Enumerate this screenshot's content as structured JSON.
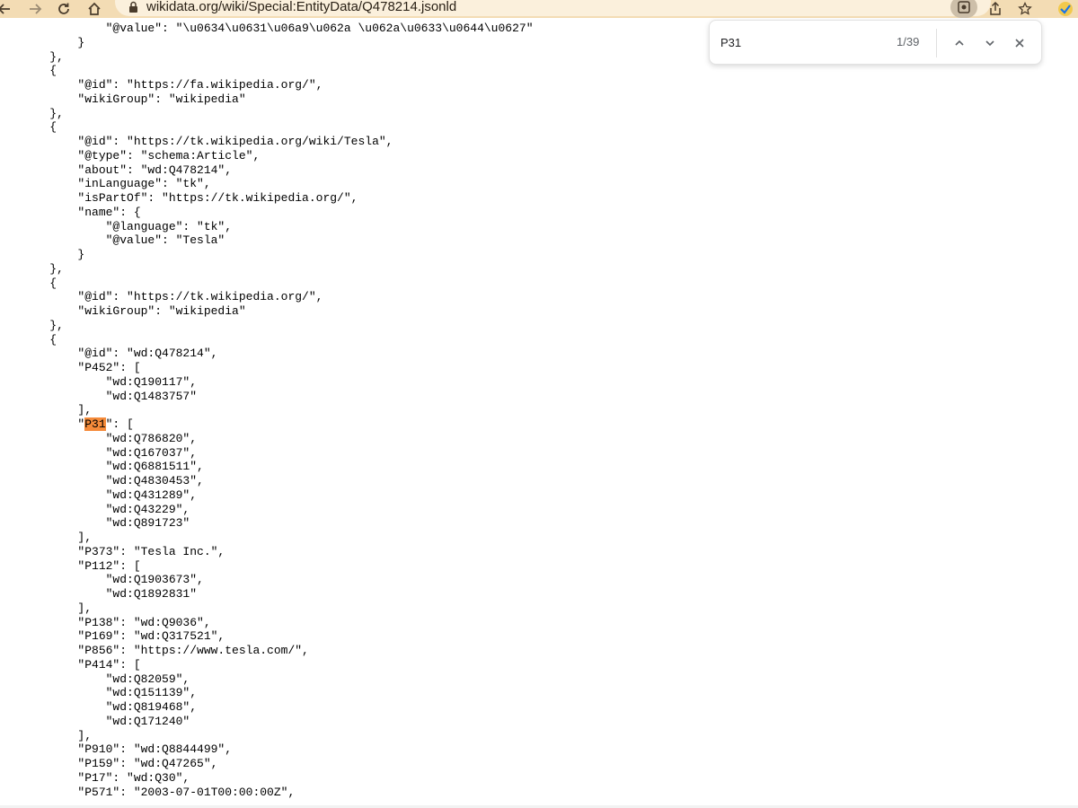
{
  "browser": {
    "url": "wikidata.org/wiki/Special:EntityData/Q478214.jsonld",
    "icons": [
      "back-icon",
      "forward-icon",
      "reload-icon",
      "home-icon",
      "lock-icon",
      "extension-icon",
      "share-icon",
      "star-icon",
      "extension-badge-icon"
    ]
  },
  "find_bar": {
    "query": "P31",
    "count": "1/39",
    "highlight_color": "#f58b3a"
  },
  "code_lines": [
    "            \"@value\": \"\\u0634\\u0631\\u06a9\\u062a \\u062a\\u0633\\u0644\\u0627\"",
    "        }",
    "    },",
    "    {",
    "        \"@id\": \"https://fa.wikipedia.org/\",",
    "        \"wikiGroup\": \"wikipedia\"",
    "    },",
    "    {",
    "        \"@id\": \"https://tk.wikipedia.org/wiki/Tesla\",",
    "        \"@type\": \"schema:Article\",",
    "        \"about\": \"wd:Q478214\",",
    "        \"inLanguage\": \"tk\",",
    "        \"isPartOf\": \"https://tk.wikipedia.org/\",",
    "        \"name\": {",
    "            \"@language\": \"tk\",",
    "            \"@value\": \"Tesla\"",
    "        }",
    "    },",
    "    {",
    "        \"@id\": \"https://tk.wikipedia.org/\",",
    "        \"wikiGroup\": \"wikipedia\"",
    "    },",
    "    {",
    "        \"@id\": \"wd:Q478214\",",
    "        \"P452\": [",
    "            \"wd:Q190117\",",
    "            \"wd:Q1483757\"",
    "        ],",
    "        \"P31\": [",
    "            \"wd:Q786820\",",
    "            \"wd:Q167037\",",
    "            \"wd:Q6881511\",",
    "            \"wd:Q4830453\",",
    "            \"wd:Q431289\",",
    "            \"wd:Q43229\",",
    "            \"wd:Q891723\"",
    "        ],",
    "        \"P373\": \"Tesla Inc.\",",
    "        \"P112\": [",
    "            \"wd:Q1903673\",",
    "            \"wd:Q1892831\"",
    "        ],",
    "        \"P138\": \"wd:Q9036\",",
    "        \"P169\": \"wd:Q317521\",",
    "        \"P856\": \"https://www.tesla.com/\",",
    "        \"P414\": [",
    "            \"wd:Q82059\",",
    "            \"wd:Q151139\",",
    "            \"wd:Q819468\",",
    "            \"wd:Q171240\"",
    "        ],",
    "        \"P910\": \"wd:Q8844499\",",
    "        \"P159\": \"wd:Q47265\",",
    "        \"P17\": \"wd:Q30\",",
    "        \"P571\": \"2003-07-01T00:00:00Z\","
  ]
}
